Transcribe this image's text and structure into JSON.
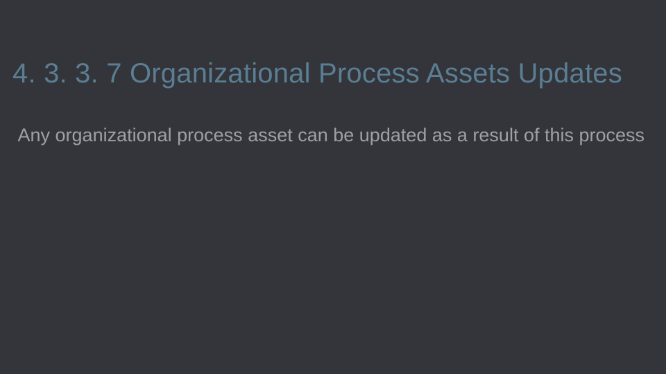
{
  "slide": {
    "title": "4. 3. 3. 7 Organizational Process Assets Updates",
    "body": " Any organizational process asset can be  updated as a result of this process"
  }
}
